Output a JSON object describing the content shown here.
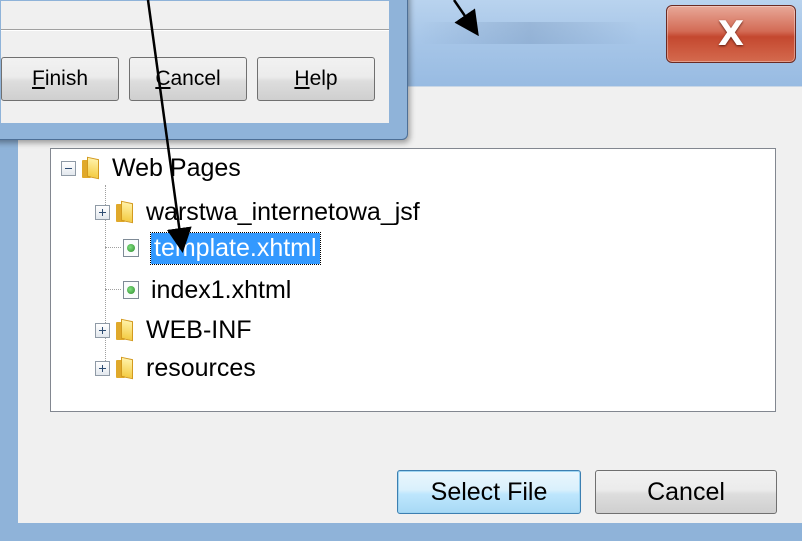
{
  "file_dialog": {
    "close_label": "X",
    "tree": {
      "root": {
        "label": "Web Pages",
        "expanded": true
      },
      "children": [
        {
          "label": "warstwa_internetowa_jsf",
          "type": "folder",
          "expanded": false
        },
        {
          "label": "template.xhtml",
          "type": "file",
          "selected": true
        },
        {
          "label": "index1.xhtml",
          "type": "file"
        },
        {
          "label": "WEB-INF",
          "type": "folder",
          "expanded": false
        },
        {
          "label": "resources",
          "type": "folder",
          "expanded": false
        }
      ]
    },
    "buttons": {
      "select_file": "Select File",
      "cancel": "Cancel"
    }
  },
  "wizard_dialog": {
    "buttons": {
      "finish": {
        "mnemonic": "F",
        "rest": "inish"
      },
      "cancel": {
        "mnemonic": "C",
        "rest": "ancel"
      },
      "help": {
        "mnemonic": "H",
        "rest": "elp"
      }
    }
  },
  "colors": {
    "selection": "#3399ff",
    "close_button": "#c4482f",
    "default_button": "#3c7fb1"
  }
}
